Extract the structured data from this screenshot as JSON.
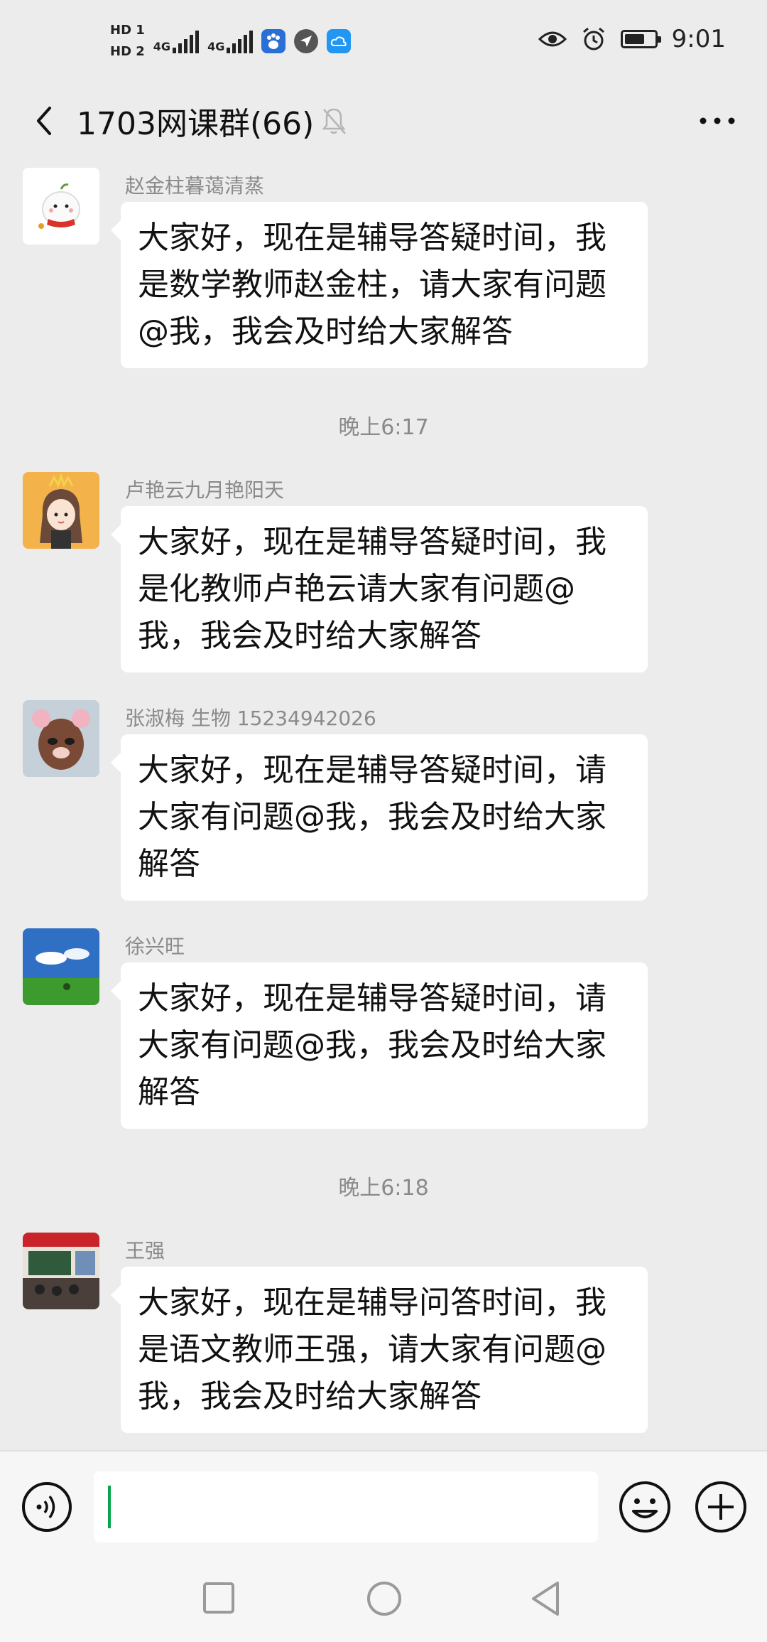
{
  "status_bar": {
    "hd1": "HD 1",
    "hd2": "HD 2",
    "net1": "4G",
    "net2": "4G",
    "time": "9:01",
    "battery_level": 0.7
  },
  "header": {
    "title": "1703网课群(66)"
  },
  "messages": [
    {
      "sender": "赵金柱暮蔼清蒸",
      "text": "大家好，现在是辅导答疑时间，我是数学教师赵金柱，请大家有问题@我，我会及时给大家解答"
    },
    {
      "timestamp": "晚上6:17"
    },
    {
      "sender": "卢艳云九月艳阳天",
      "text": "大家好，现在是辅导答疑时间，我是化教师卢艳云请大家有问题@我，我会及时给大家解答"
    },
    {
      "sender": "张淑梅 生物 15234942026",
      "text": "大家好，现在是辅导答疑时间，请大家有问题@我，我会及时给大家解答"
    },
    {
      "sender": "徐兴旺",
      "text": "大家好，现在是辅导答疑时间，请大家有问题@我，我会及时给大家解答"
    },
    {
      "timestamp": "晚上6:18"
    },
    {
      "sender": "王强",
      "text": "大家好，现在是辅导问答时间，我是语文教师王强，请大家有问题@我，我会及时给大家解答"
    }
  ],
  "input": {
    "value": ""
  },
  "colors": {
    "background": "#ececec",
    "bubble": "#ffffff",
    "cursor": "#07a44c"
  }
}
